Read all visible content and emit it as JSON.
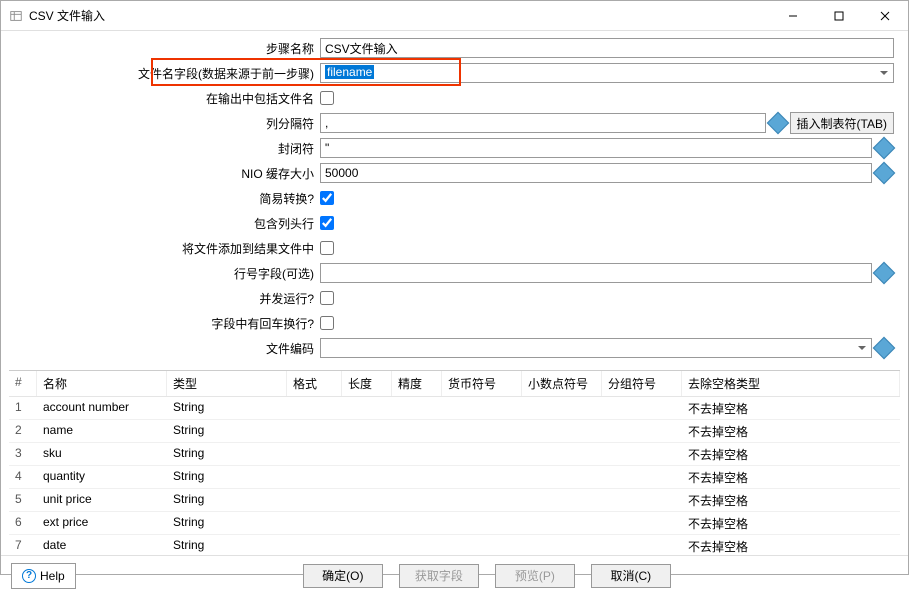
{
  "window": {
    "title": "CSV 文件输入"
  },
  "form": {
    "step_name_label": "步骤名称",
    "step_name_value": "CSV文件输入",
    "filename_field_label": "文件名字段(数据来源于前一步骤)",
    "filename_field_value": "filename",
    "include_filename_label": "在输出中包括文件名",
    "delimiter_label": "列分隔符",
    "delimiter_value": ",",
    "insert_tab_label": "插入制表符(TAB)",
    "enclosure_label": "封闭符",
    "enclosure_value": "\"",
    "nio_label": "NIO 缓存大小",
    "nio_value": "50000",
    "lazy_label": "简易转换?",
    "header_label": "包含列头行",
    "add_to_result_label": "将文件添加到结果文件中",
    "rownum_label": "行号字段(可选)",
    "rownum_value": "",
    "parallel_label": "并发运行?",
    "newline_in_field_label": "字段中有回车换行?",
    "encoding_label": "文件编码",
    "encoding_value": ""
  },
  "grid": {
    "headers": {
      "num": "#",
      "name": "名称",
      "type": "类型",
      "format": "格式",
      "length": "长度",
      "precision": "精度",
      "currency": "货币符号",
      "decimal": "小数点符号",
      "group": "分组符号",
      "trim": "去除空格类型"
    },
    "rows": [
      {
        "n": "1",
        "name": "account number",
        "type": "String",
        "trim": "不去掉空格"
      },
      {
        "n": "2",
        "name": "name",
        "type": "String",
        "trim": "不去掉空格"
      },
      {
        "n": "3",
        "name": "sku",
        "type": "String",
        "trim": "不去掉空格"
      },
      {
        "n": "4",
        "name": "quantity",
        "type": "String",
        "trim": "不去掉空格"
      },
      {
        "n": "5",
        "name": "unit price",
        "type": "String",
        "trim": "不去掉空格"
      },
      {
        "n": "6",
        "name": "ext price",
        "type": "String",
        "trim": "不去掉空格"
      },
      {
        "n": "7",
        "name": "date",
        "type": "String",
        "trim": "不去掉空格"
      }
    ]
  },
  "footer": {
    "help": "Help",
    "ok": "确定(O)",
    "get_fields": "获取字段",
    "preview": "预览(P)",
    "cancel": "取消(C)"
  }
}
